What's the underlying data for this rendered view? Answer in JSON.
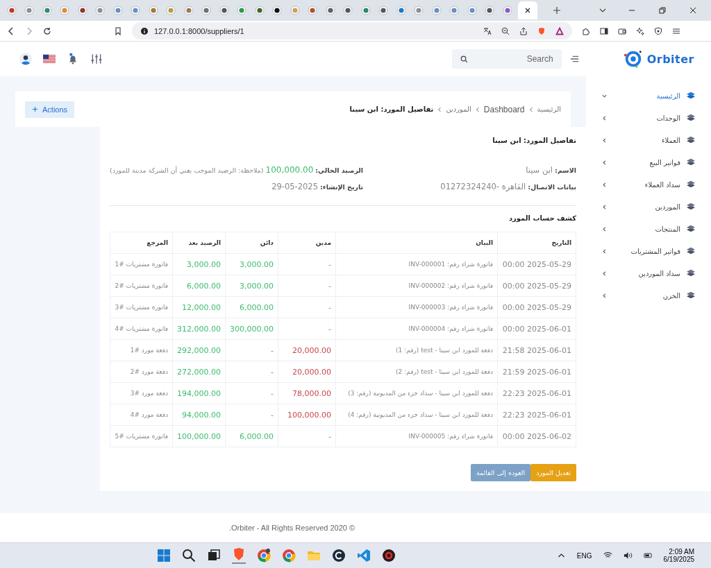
{
  "browser": {
    "tabs": [
      {
        "selected": false,
        "color": "#c0392b"
      },
      {
        "selected": false,
        "color": "#8a9099"
      },
      {
        "selected": false,
        "color": "#2e8b7a"
      },
      {
        "selected": false,
        "color": "#d98c3a"
      },
      {
        "selected": false,
        "color": "#8b3a2e"
      },
      {
        "selected": false,
        "color": "#8a9099"
      },
      {
        "selected": false,
        "color": "#6a8fc7"
      },
      {
        "selected": false,
        "color": "#6a8fc7"
      },
      {
        "selected": false,
        "color": "#a07a3a"
      },
      {
        "selected": false,
        "color": "#b0a040"
      },
      {
        "selected": false,
        "color": "#9a7a5a"
      },
      {
        "selected": false,
        "color": "#707070"
      },
      {
        "selected": false,
        "color": "#505860"
      },
      {
        "selected": false,
        "color": "#2a9d4a"
      },
      {
        "selected": false,
        "color": "#3a6a2a"
      },
      {
        "selected": false,
        "color": "#111111"
      },
      {
        "selected": false,
        "color": "#c8a060"
      },
      {
        "selected": false,
        "color": "#b05030"
      },
      {
        "selected": false,
        "color": "#606060"
      },
      {
        "selected": false,
        "color": "#505860"
      },
      {
        "selected": false,
        "color": "#2a8a6a"
      },
      {
        "selected": false,
        "color": "#505860"
      },
      {
        "selected": false,
        "color": "#1a7ad0"
      },
      {
        "selected": false,
        "color": "#8a9099"
      },
      {
        "selected": false,
        "color": "#6a8fc7"
      },
      {
        "selected": false,
        "color": "#6a8fc7"
      },
      {
        "selected": false,
        "color": "#6a8fc7"
      },
      {
        "selected": false,
        "color": "#505860"
      },
      {
        "selected": false,
        "color": "#8a5ad0"
      },
      {
        "selected": true
      }
    ],
    "address": "127.0.0.1:8000/suppliers/1"
  },
  "header": {
    "brand": "Orbiter",
    "search": {
      "placeholder": "Search"
    }
  },
  "sidebar": {
    "items": [
      {
        "label": "الرئيسية",
        "selected": true,
        "expanded": true
      },
      {
        "label": "الوحدات",
        "selected": false,
        "expanded": false
      },
      {
        "label": "العملاء",
        "selected": false,
        "expanded": false
      },
      {
        "label": "فواتير البيع",
        "selected": false,
        "expanded": false
      },
      {
        "label": "سداد العملاء",
        "selected": false,
        "expanded": false
      },
      {
        "label": "الموردين",
        "selected": false,
        "expanded": false
      },
      {
        "label": "المنتجات",
        "selected": false,
        "expanded": false
      },
      {
        "label": "فواتير المشتريات",
        "selected": false,
        "expanded": false
      },
      {
        "label": "سداد الموردين",
        "selected": false,
        "expanded": false
      },
      {
        "label": "الخزن",
        "selected": false,
        "expanded": false
      }
    ]
  },
  "breadcrumb": [
    {
      "label": "الرئيسية",
      "current": false
    },
    {
      "label": "Dashboard",
      "current": false
    },
    {
      "label": "الموردين",
      "current": false
    },
    {
      "label": "تفاصيل المورد: ابن سينا",
      "current": true
    }
  ],
  "actions_button": "Actions",
  "details": {
    "title": "تفاصيل المورد: ابن سينا",
    "fields": [
      {
        "kind": "text",
        "label": "الاسم:",
        "value": "ابن سينا"
      },
      {
        "kind": "amount",
        "label": "الرصيد الحالي:",
        "value": "100,000.00",
        "note": "(ملاحظة: الرصيد الموجب يعني أن الشركة مدينة للمورد)"
      },
      {
        "kind": "text",
        "label": "بيانات الاتصال:",
        "value": "القاهرة -01272324240"
      },
      {
        "kind": "text",
        "label": "تاريخ الإنشاء:",
        "value": "29-05-2025"
      }
    ]
  },
  "statement": {
    "title": "كشف حساب المورد",
    "columns": [
      "التاريخ",
      "البيان",
      "مدين",
      "دائن",
      "الرصيد بعد",
      "المرجع"
    ],
    "rows": [
      {
        "date": "2025-05-29 00:00",
        "description": "فاتورة شراء رقم: INV-000001",
        "debit": "-",
        "credit": "3,000.00",
        "balance_after": "3,000.00",
        "reference": "فاتورة مشتريات #1"
      },
      {
        "date": "2025-05-29 00:00",
        "description": "فاتورة شراء رقم: INV-000002",
        "debit": "-",
        "credit": "3,000.00",
        "balance_after": "6,000.00",
        "reference": "فاتورة مشتريات #2"
      },
      {
        "date": "2025-05-29 00:00",
        "description": "فاتورة شراء رقم: INV-000003",
        "debit": "-",
        "credit": "6,000.00",
        "balance_after": "12,000.00",
        "reference": "فاتورة مشتريات #3"
      },
      {
        "date": "2025-06-01 00:00",
        "description": "فاتورة شراء رقم: INV-000004",
        "debit": "-",
        "credit": "300,000.00",
        "balance_after": "312,000.00",
        "reference": "فاتورة مشتريات #4"
      },
      {
        "date": "2025-06-01 21:58",
        "description": "دفعة للمورد ابن سينا - test (رقم: 1)",
        "debit": "20,000.00",
        "credit": "-",
        "balance_after": "292,000.00",
        "reference": "دفعة مورد #1"
      },
      {
        "date": "2025-06-01 21:59",
        "description": "دفعة للمورد ابن سينا - test (رقم: 2)",
        "debit": "20,000.00",
        "credit": "-",
        "balance_after": "272,000.00",
        "reference": "دفعة مورد #2"
      },
      {
        "date": "2025-06-01 22:23",
        "description": "دفعة للمورد ابن سينا - سداد جزء من المديونية (رقم: 3)",
        "debit": "78,000.00",
        "credit": "-",
        "balance_after": "194,000.00",
        "reference": "دفعة مورد #3"
      },
      {
        "date": "2025-06-01 22:23",
        "description": "دفعة للمورد ابن سينا - سداد جزء من المديونية (رقم: 4)",
        "debit": "100,000.00",
        "credit": "-",
        "balance_after": "94,000.00",
        "reference": "دفعة مورد #4"
      },
      {
        "date": "2025-06-02 00:00",
        "description": "فاتورة شراء رقم: INV-000005",
        "debit": "-",
        "credit": "6,000.00",
        "balance_after": "100,000.00",
        "reference": "فاتورة مشتريات #5"
      }
    ]
  },
  "buttons": [
    {
      "label": "تعديل المورد",
      "kind": "warning"
    },
    {
      "label": "العوده إلى القائمة",
      "kind": "secondary"
    }
  ],
  "footer": ".Orbiter - All Rights Reserved 2020 ©",
  "taskbar": {
    "language": "ENG",
    "time": "2:09 AM",
    "date": "6/19/2025"
  }
}
